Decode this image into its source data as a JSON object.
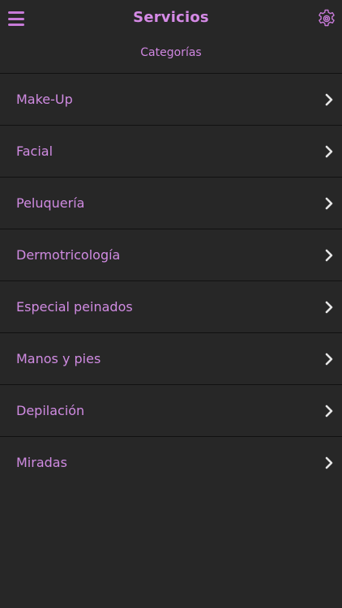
{
  "header": {
    "title": "Servicios",
    "subtitle": "Categorías",
    "menu_icon": "hamburger-menu-icon",
    "settings_icon": "gear-icon"
  },
  "categories": [
    {
      "label": "Make-Up"
    },
    {
      "label": "Facial"
    },
    {
      "label": "Peluquería"
    },
    {
      "label": "Dermotricología"
    },
    {
      "label": "Especial peinados"
    },
    {
      "label": "Manos y pies"
    },
    {
      "label": "Depilación"
    },
    {
      "label": "Miradas"
    }
  ],
  "colors": {
    "background": "#272727",
    "accent": "#d08be2",
    "divider": "#111111",
    "chevron": "#e6e6e6"
  }
}
